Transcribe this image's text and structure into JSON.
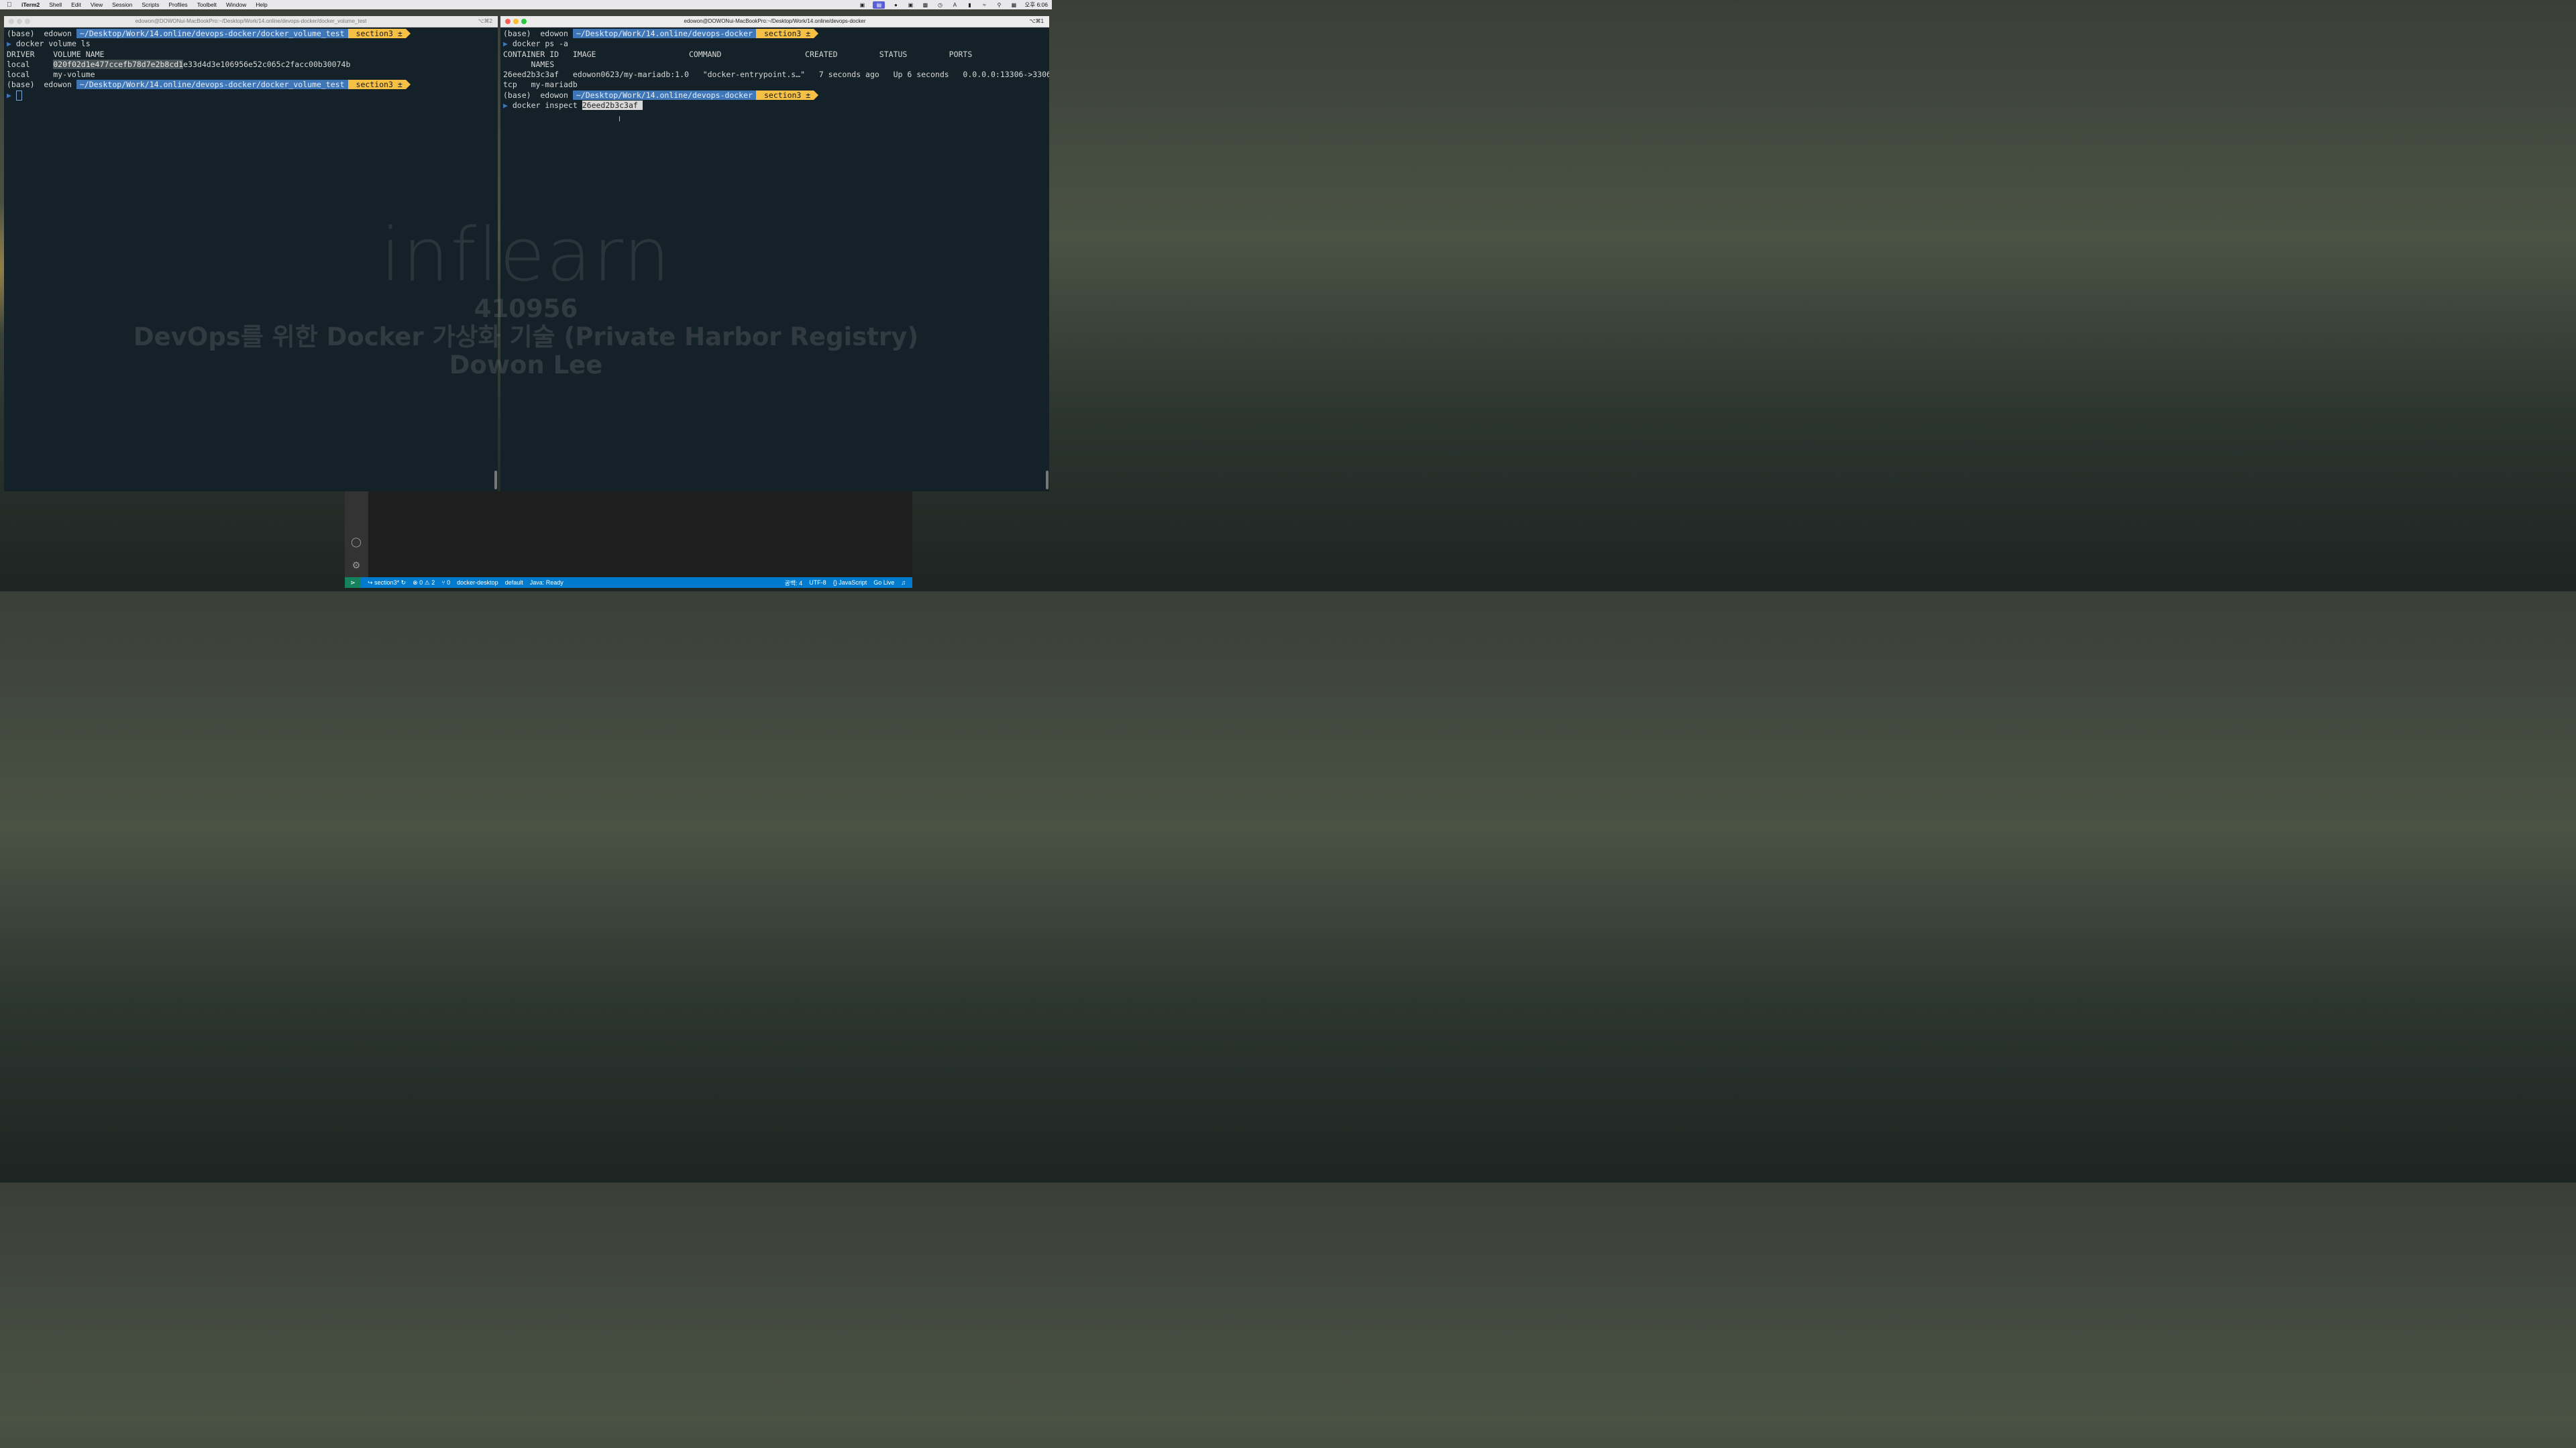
{
  "menubar": {
    "app": "iTerm2",
    "items": [
      "Shell",
      "Edit",
      "View",
      "Session",
      "Scripts",
      "Profiles",
      "Toolbelt",
      "Window",
      "Help"
    ],
    "clock": "오후 6:06"
  },
  "left_window": {
    "title": "edowon@DOWONui-MacBookPro:~/Desktop/Work/14.online/devops-docker/docker_volume_test",
    "shortcut": "⌥⌘2",
    "prompt_base": "(base)  edowon ",
    "prompt_path": "~/Desktop/Work/14.online/devops-docker/docker_volume_test",
    "prompt_git": "section3 ±",
    "cmd1": "docker volume ls",
    "header": "DRIVER    VOLUME NAME",
    "row1_driver": "local     ",
    "row1_sel": "020f02d1e477ccefb78d7e2b8cd1",
    "row1_rest": "e33d4d3e106956e52c065c2facc00b30074b",
    "row2": "local     my-volume"
  },
  "right_window": {
    "title": "edowon@DOWONui-MacBookPro:~/Desktop/Work/14.online/devops-docker",
    "shortcut": "⌥⌘1",
    "prompt_base": "(base)  edowon ",
    "prompt_path": "~/Desktop/Work/14.online/devops-docker",
    "prompt_git": "section3 ±",
    "cmd1": "docker ps -a",
    "header1": "CONTAINER ID   IMAGE                    COMMAND                  CREATED         STATUS         PORTS",
    "header2": "      NAMES",
    "row1": "26eed2b3c3af   edowon0623/my-mariadb:1.0   \"docker-entrypoint.s…\"   7 seconds ago   Up 6 seconds   0.0.0.0:13306->3306/",
    "row2": "tcp   my-mariadb",
    "cmd2_prefix": "docker inspect ",
    "cmd2_sel": "26eed2b3c3af "
  },
  "vscode_status": {
    "branch": "section3*",
    "errors": "⊗ 0 ⚠ 2",
    "ports": "⑂ 0",
    "context": "docker-desktop",
    "namespace": "default",
    "java": "Java: Ready",
    "spaces": "공백: 4",
    "encoding": "UTF-8",
    "language": "{} JavaScript",
    "golive": "Go Live"
  },
  "watermark": {
    "logo": "inflearn",
    "id": "410956",
    "course": "DevOps를 위한 Docker 가상화 기술 (Private Harbor Registry)",
    "author": "Dowon Lee"
  }
}
